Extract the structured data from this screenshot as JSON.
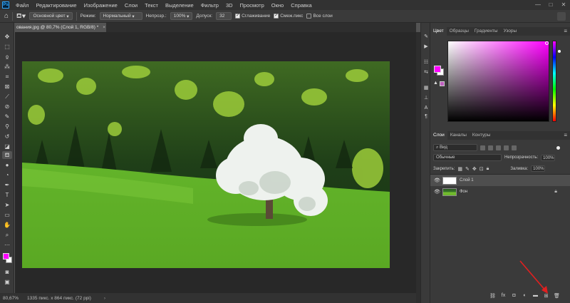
{
  "app": {
    "logo": "Ps"
  },
  "menu": [
    "Файл",
    "Редактирование",
    "Изображение",
    "Слои",
    "Текст",
    "Выделение",
    "Фильтр",
    "3D",
    "Просмотр",
    "Окно",
    "Справка"
  ],
  "window_controls": [
    "—",
    "□",
    "✕"
  ],
  "options": {
    "fill_source": "Основной цвет",
    "mode_label": "Режим:",
    "mode_value": "Нормальный",
    "opacity_label": "Непрозр.:",
    "opacity_value": "100%",
    "tolerance_label": "Допуск:",
    "tolerance_value": "32",
    "antialias_label": "Сглаживание",
    "contiguous_label": "Смеж.пикс",
    "all_layers_label": "Все слои"
  },
  "document": {
    "tab_title": "ования.jpg @ 80,7% (Слой 1, RGB/8) *",
    "close": "×"
  },
  "status": {
    "zoom": "80,67%",
    "info": "1335 пикс. х 864 пикс. (72 ppi)",
    "arrow": "›"
  },
  "color_panel": {
    "tabs": [
      "Цвет",
      "Образцы",
      "Градиенты",
      "Узоры"
    ],
    "active_tab": 0,
    "foreground": "#ff00ff",
    "background": "#ffffff",
    "hue": "#ff00ff"
  },
  "layers_panel": {
    "tabs": [
      "Слои",
      "Каналы",
      "Контуры"
    ],
    "active_tab": 0,
    "filter_placeholder": "Вид",
    "blend_mode": "Обычные",
    "opacity_label": "Непрозрачность:",
    "opacity_value": "100%",
    "lock_label": "Закрепить:",
    "fill_label": "Заливка:",
    "fill_value": "100%",
    "layers": [
      {
        "name": "Слой 1",
        "selected": true,
        "thumb": "white",
        "locked": false
      },
      {
        "name": "Фон",
        "selected": false,
        "thumb": "photo",
        "locked": true
      }
    ],
    "bottom_icons": [
      "link-icon",
      "fx-icon",
      "mask-icon",
      "adjustment-icon",
      "group-icon",
      "new-layer-icon",
      "trash-icon"
    ]
  },
  "colors": {
    "accent_arrow": "#e02020",
    "foreground": "#ff00ff"
  }
}
